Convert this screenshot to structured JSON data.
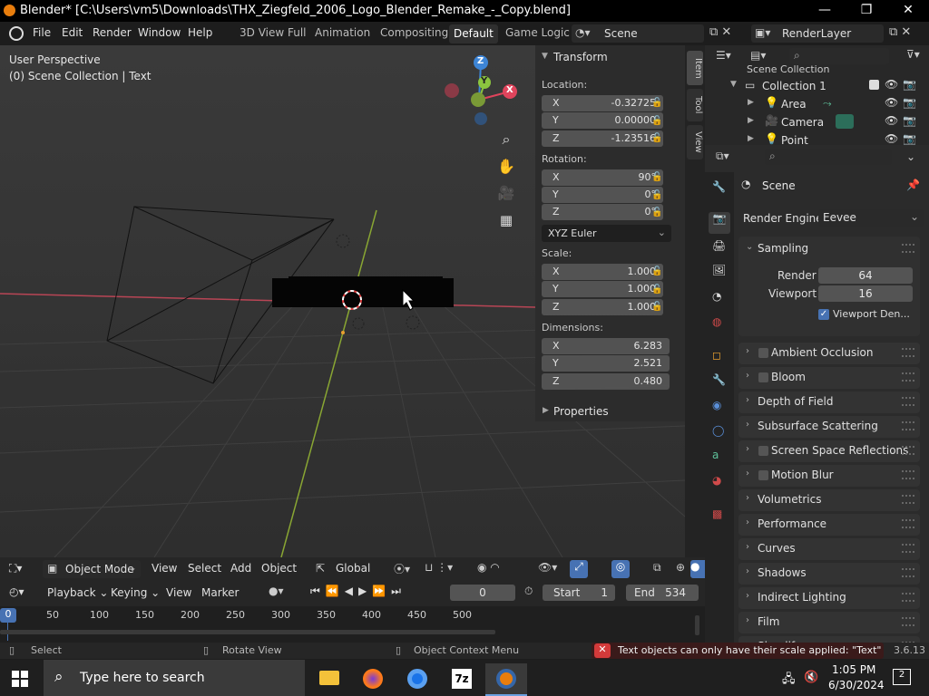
{
  "window": {
    "title": "Blender* [C:\\Users\\vm5\\Downloads\\THX_Ziegfeld_2006_Logo_Blender_Remake_-_Copy.blend]",
    "minimize": "—",
    "maximize": "❐",
    "close": "✕"
  },
  "menu": {
    "items": [
      "File",
      "Edit",
      "Render",
      "Window",
      "Help"
    ],
    "workspaces": [
      "3D View Full",
      "Animation",
      "Compositing",
      "Default",
      "Game Logic"
    ],
    "active_workspace": "Default",
    "scene": "Scene",
    "render_layer": "RenderLayer"
  },
  "viewport": {
    "perspective": "User Perspective",
    "collection_info": "(0) Scene Collection | Text",
    "gizmo": {
      "x": "X",
      "y": "Y",
      "z": "Z"
    }
  },
  "npanel": {
    "tabs": [
      "Item",
      "Tool",
      "View"
    ],
    "transform_header": "Transform",
    "location_label": "Location:",
    "location": [
      {
        "axis": "X",
        "value": "-0.32725"
      },
      {
        "axis": "Y",
        "value": "0.00000"
      },
      {
        "axis": "Z",
        "value": "-1.23516"
      }
    ],
    "rotation_label": "Rotation:",
    "rotation": [
      {
        "axis": "X",
        "value": "90°"
      },
      {
        "axis": "Y",
        "value": "0°"
      },
      {
        "axis": "Z",
        "value": "0°"
      }
    ],
    "rotation_mode": "XYZ Euler",
    "scale_label": "Scale:",
    "scale": [
      {
        "axis": "X",
        "value": "1.000"
      },
      {
        "axis": "Y",
        "value": "1.000"
      },
      {
        "axis": "Z",
        "value": "1.000"
      }
    ],
    "dimensions_label": "Dimensions:",
    "dimensions": [
      {
        "axis": "X",
        "value": "6.283"
      },
      {
        "axis": "Y",
        "value": "2.521"
      },
      {
        "axis": "Z",
        "value": "0.480"
      }
    ],
    "properties_header": "Properties"
  },
  "vpheader": {
    "mode": "Object Mode",
    "view": "View",
    "select": "Select",
    "add": "Add",
    "object": "Object",
    "orientation": "Global"
  },
  "timeline": {
    "playback": "Playback",
    "keying": "Keying",
    "view": "View",
    "marker": "Marker",
    "current_frame": "0",
    "start_label": "Start",
    "start": "1",
    "end_label": "End",
    "end": "534",
    "ticks": [
      "0",
      "50",
      "100",
      "150",
      "200",
      "250",
      "300",
      "350",
      "400",
      "450",
      "500"
    ]
  },
  "outliner": {
    "root": "Scene Collection",
    "collection": "Collection 1",
    "items": [
      "Area",
      "Camera",
      "Point"
    ]
  },
  "props": {
    "context": "Scene",
    "render_engine_label": "Render Engine",
    "render_engine": "Eevee",
    "sampling": "Sampling",
    "render_label": "Render",
    "render_value": "64",
    "viewport_label": "Viewport",
    "viewport_value": "16",
    "viewport_denoise": "Viewport Den...",
    "sections": [
      {
        "label": "Ambient Occlusion",
        "checkbox": true
      },
      {
        "label": "Bloom",
        "checkbox": true
      },
      {
        "label": "Depth of Field",
        "checkbox": false
      },
      {
        "label": "Subsurface Scattering",
        "checkbox": false
      },
      {
        "label": "Screen Space Reflections",
        "checkbox": true
      },
      {
        "label": "Motion Blur",
        "checkbox": true
      },
      {
        "label": "Volumetrics",
        "checkbox": false
      },
      {
        "label": "Performance",
        "checkbox": false
      },
      {
        "label": "Curves",
        "checkbox": false
      },
      {
        "label": "Shadows",
        "checkbox": false
      },
      {
        "label": "Indirect Lighting",
        "checkbox": false
      },
      {
        "label": "Film",
        "checkbox": false
      },
      {
        "label": "Simplify",
        "checkbox": false
      }
    ]
  },
  "status": {
    "select": "Select",
    "rotate": "Rotate View",
    "context_menu": "Object Context Menu",
    "error": "Text objects can only have their scale applied: \"Text\"",
    "version": "3.6.13"
  },
  "taskbar": {
    "search_placeholder": "Type here to search",
    "time": "1:05 PM",
    "date": "6/30/2024",
    "notifications": "2"
  },
  "colors": {
    "accent": "#4772b3",
    "blender_orange": "#e87d0d",
    "error_red": "#d33a3a",
    "x_axis": "#e0445c",
    "y_axis": "#8bc53f",
    "z_axis": "#3d85d6"
  }
}
